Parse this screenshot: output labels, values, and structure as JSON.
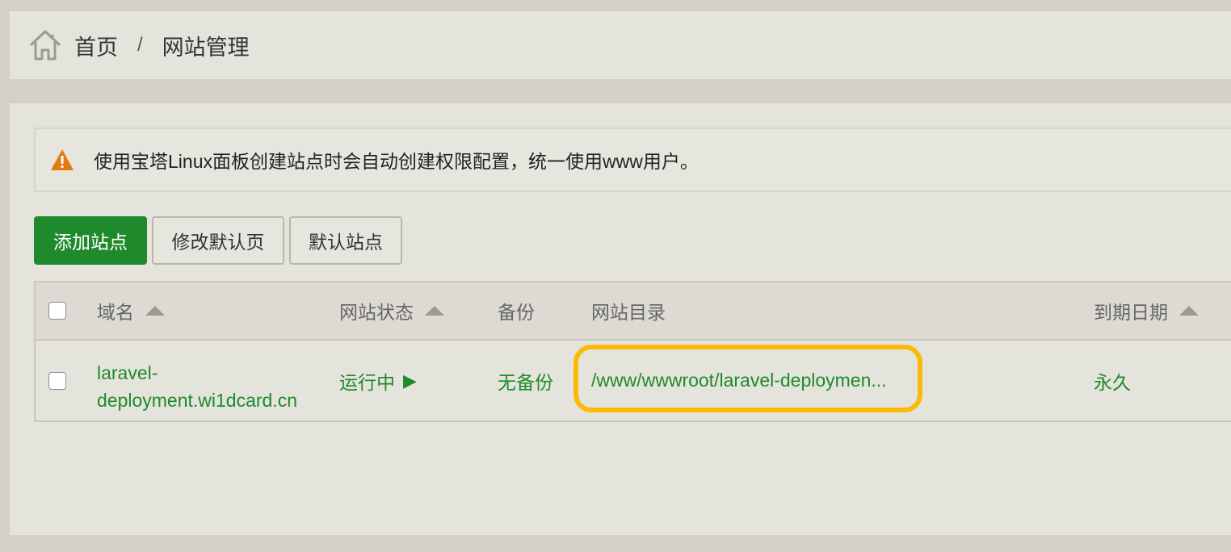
{
  "breadcrumb": {
    "home_label": "首页",
    "separator": "/",
    "current": "网站管理"
  },
  "alert": {
    "icon": "warning-icon",
    "text": "使用宝塔Linux面板创建站点时会自动创建权限配置，统一使用www用户。"
  },
  "toolbar": {
    "add_site": "添加站点",
    "edit_default_page": "修改默认页",
    "default_site": "默认站点"
  },
  "table": {
    "headers": {
      "domain": "域名",
      "status": "网站状态",
      "backup": "备份",
      "directory": "网站目录",
      "expiry": "到期日期"
    },
    "rows": [
      {
        "domain": "laravel-deployment.wi1dcard.cn",
        "domain_line1": "laravel-",
        "domain_line2": "deployment.wi1dcard.cn",
        "status": "运行中",
        "backup": "无备份",
        "directory": "/www/wwwroot/laravel-deploymen...",
        "expiry": "永久"
      }
    ]
  },
  "colors": {
    "accent_green": "#1e8a2b",
    "highlight": "#fbb908",
    "warning": "#e07b12"
  }
}
